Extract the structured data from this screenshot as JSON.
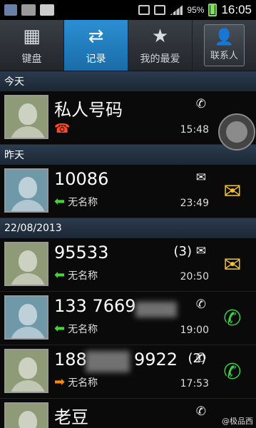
{
  "status": {
    "battery": "95%",
    "time": "16:05"
  },
  "tabs": [
    {
      "label": "键盘",
      "icon": "keypad-icon"
    },
    {
      "label": "记录",
      "icon": "call-log-arrows-icon"
    },
    {
      "label": "我的最爱",
      "icon": "star-icon"
    },
    {
      "label": "联系人",
      "icon": "contact-person-icon"
    }
  ],
  "sections": [
    "今天",
    "昨天",
    "22/08/2013"
  ],
  "rows": [
    {
      "name": "私人号码",
      "kind": "✆",
      "time": "15:48",
      "type": "",
      "action": ""
    },
    {
      "name": "10086",
      "kind": "✉",
      "time": "23:49",
      "type": "无名称",
      "action": "✉"
    },
    {
      "name": "95533",
      "kind": "✉",
      "count": "(3)",
      "time": "20:50",
      "type": "无名称",
      "action": "✉"
    },
    {
      "name": "133 7669",
      "kind": "✆",
      "time": "19:00",
      "type": "无名称",
      "action": "✆"
    },
    {
      "name": "188",
      "name2": "9922",
      "count": "(2)",
      "kind": "✆",
      "time": "17:53",
      "type": "无名称",
      "action": "✆"
    },
    {
      "name": "老豆",
      "kind": "✆",
      "time": "",
      "type": "",
      "action": ""
    }
  ],
  "watermark": "@极品西"
}
